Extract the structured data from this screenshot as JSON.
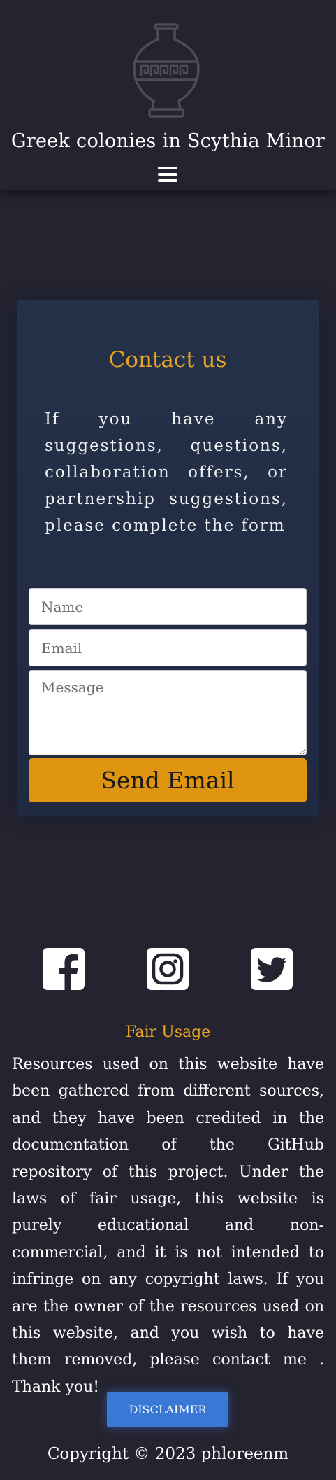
{
  "header": {
    "logo_icon": "greek-vase-icon",
    "title": "Greek colonies in Scythia Minor",
    "menu_icon": "hamburger-menu-icon"
  },
  "contact": {
    "title": "Contact us",
    "intro": "If you have any suggestions, questions, collaboration offers, or partnership suggestions, please complete the form",
    "name_placeholder": "Name",
    "email_placeholder": "Email",
    "message_placeholder": "Message",
    "send_label": "Send Email",
    "accent_color": "#e09512"
  },
  "footer": {
    "social": [
      {
        "name": "facebook-icon"
      },
      {
        "name": "instagram-icon"
      },
      {
        "name": "twitter-icon"
      }
    ],
    "fair_title": "Fair Usage",
    "fair_text": "Resources used on this website have been gathered from different sources, and they have been credited in the documentation of the GitHub repository of this project. Under the laws of fair usage, this website is purely educational and non-commercial, and it is not intended to infringe on any copyright laws. If you are the owner of the resources used on this website, and you wish to have them removed, please contact me . Thank you!",
    "disclaimer_label": "DISCLAIMER",
    "copyright": "Copyright © 2023 phloreenm",
    "button_color": "#3a78d6"
  }
}
